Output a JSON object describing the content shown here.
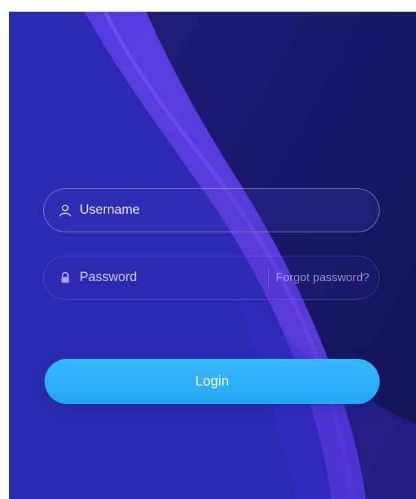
{
  "login_form": {
    "username": {
      "placeholder": "Username",
      "icon": "user-icon"
    },
    "password": {
      "placeholder": "Password",
      "icon": "lock-icon"
    },
    "forgot_password_label": "Forgot password?",
    "login_label": "Login"
  },
  "colors": {
    "background": "#2623a8",
    "button": "#22a6f2",
    "text": "#ffffff"
  }
}
